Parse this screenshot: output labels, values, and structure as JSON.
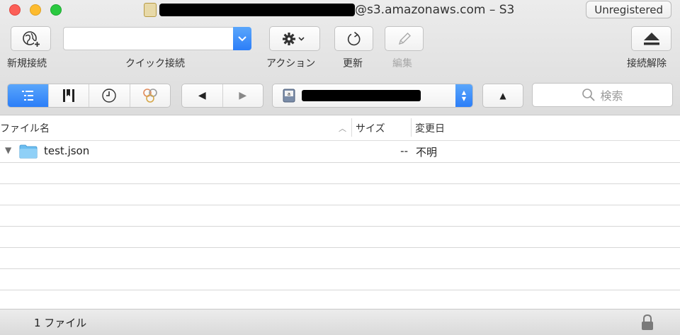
{
  "window": {
    "title_suffix": "@s3.amazonaws.com – S3",
    "unregistered_label": "Unregistered"
  },
  "toolbar": {
    "new_connection": "新規接続",
    "quick_connect": "クイック接続",
    "action": "アクション",
    "refresh": "更新",
    "edit": "編集",
    "disconnect": "接続解除"
  },
  "search": {
    "placeholder": "検索"
  },
  "columns": {
    "name": "ファイル名",
    "size": "サイズ",
    "modified": "変更日"
  },
  "files": [
    {
      "name": "test.json",
      "size": "--",
      "modified": "不明",
      "icon": "folder-icon"
    }
  ],
  "status": {
    "count": "1 ファイル"
  },
  "colors": {
    "accent": "#2C7EF8",
    "folder": "#6CBEF0"
  }
}
